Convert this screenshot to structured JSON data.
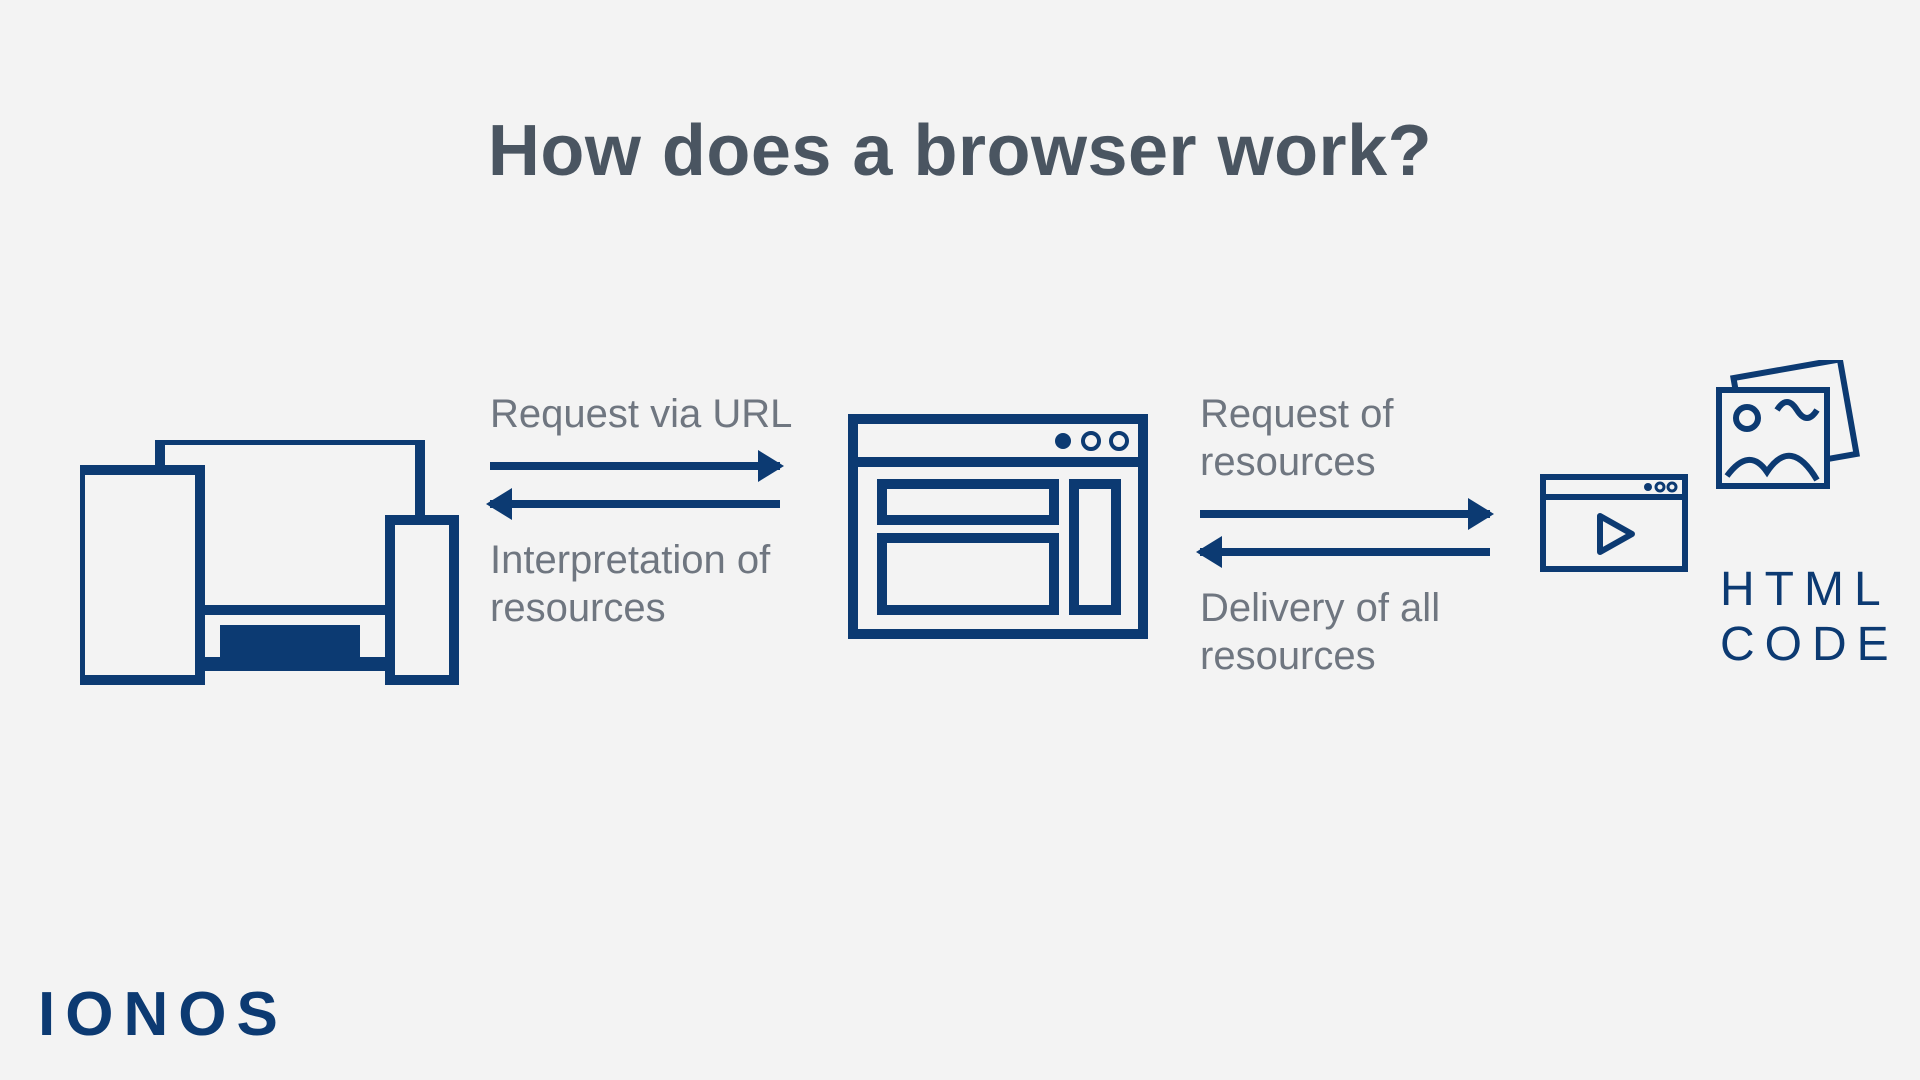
{
  "title": "How does a browser work?",
  "flow1": {
    "top": "Request via URL",
    "bottom": "Interpretation of resources"
  },
  "flow2": {
    "top": "Request of resources",
    "bottom": "Delivery of all resources"
  },
  "resources_label": "HTML CODE",
  "logo": "IONOS",
  "colors": {
    "brand": "#0c3a72",
    "text": "#4a5561",
    "muted": "#6f7680",
    "bg": "#f3f3f3"
  }
}
